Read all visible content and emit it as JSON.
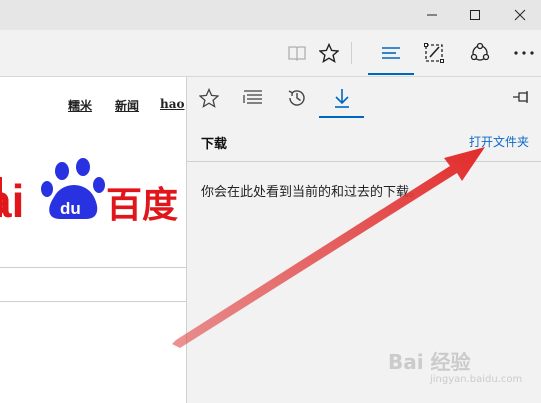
{
  "toolbar": {
    "reading_view": "reading-view-icon",
    "favorite": "star-icon",
    "hub": "hub-icon",
    "notes": "web-note-icon",
    "share": "share-icon",
    "more": "more-icon"
  },
  "page": {
    "nav_links": [
      "糯米",
      "新闻",
      "hao"
    ],
    "logo_text": "Bai du 百度",
    "logo_colors": {
      "red": "#e0161a",
      "blue": "#2932e1"
    }
  },
  "hub": {
    "tabs": [
      "favorites-tab",
      "reading-list-tab",
      "history-tab",
      "downloads-tab"
    ],
    "section_title": "下载",
    "open_folder": "打开文件夹",
    "empty_message": "你会在此处看到当前的和过去的下载。"
  },
  "watermark": {
    "text": "Bai 经验",
    "sub": "jingyan.baidu.com"
  }
}
